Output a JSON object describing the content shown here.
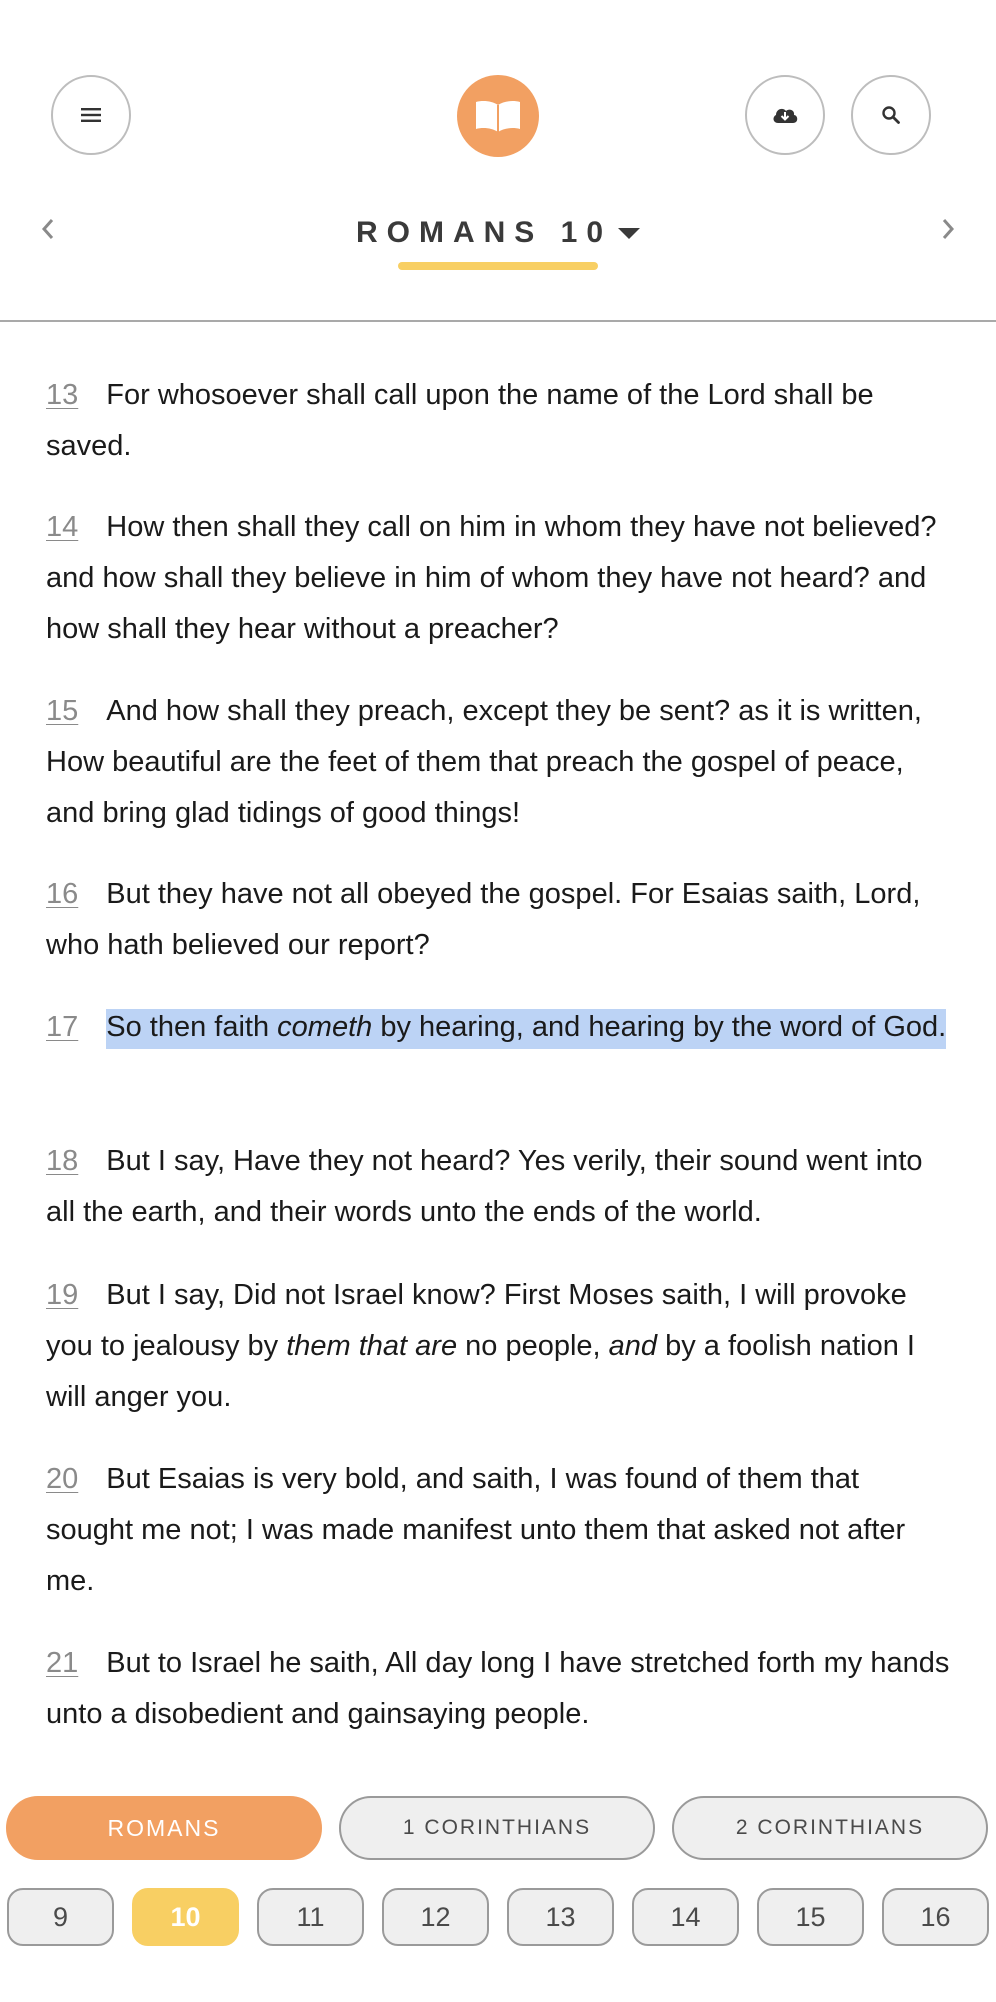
{
  "header": {
    "chapter_label": "ROMANS 10",
    "icons": {
      "menu": "hamburger-menu-icon",
      "logo": "open-book-icon",
      "download": "cloud-download-icon",
      "search": "search-icon",
      "prev": "chevron-left-icon",
      "next": "chevron-right-icon",
      "dropdown": "caret-down-icon"
    }
  },
  "colors": {
    "accent_orange": "#f2a062",
    "accent_yellow": "#f8cf63",
    "highlight_blue": "#bcd3f5"
  },
  "verses": [
    {
      "num": "13",
      "text": "For whosoever shall call upon the name of the Lord shall be saved."
    },
    {
      "num": "14",
      "text": "How then shall they call on him in whom they have not believed? and how shall they believe in him of whom they have not heard? and how shall they hear without a preacher?"
    },
    {
      "num": "15",
      "text": "And how shall they preach, except they be sent? as it is written, How beautiful are the feet of them that preach the gospel of peace, and bring glad tidings of good things!"
    },
    {
      "num": "16",
      "text": "But they have not all obeyed the gospel. For Esaias saith, Lord, who hath believed our report?"
    },
    {
      "num": "17",
      "text_a": "So then faith ",
      "text_italic": "cometh",
      "text_b": " by hearing, and hearing by the word of God.",
      "highlighted": true
    },
    {
      "num": "18",
      "text": "But I say, Have they not heard? Yes verily, their sound went into all the earth, and their words unto the ends of the world."
    },
    {
      "num": "19",
      "text_a": "But I say, Did not Israel know? First Moses saith, I will provoke you to jealousy by ",
      "text_italic_1": "them that are",
      "text_b": " no people, ",
      "text_italic_2": "and",
      "text_c": " by a foolish nation I will anger you."
    },
    {
      "num": "20",
      "text": "But Esaias is very bold, and saith, I was found of them that sought me not; I was made manifest unto them that asked not after me."
    },
    {
      "num": "21",
      "text": "But to Israel he saith, All day long I have stretched forth my hands unto a disobedient and gainsaying people."
    }
  ],
  "books": [
    {
      "label": "ROMANS",
      "active": true
    },
    {
      "label": "1 CORINTHIANS",
      "active": false
    },
    {
      "label": "2 CORINTHIANS",
      "active": false
    }
  ],
  "chapters": [
    {
      "label": "9",
      "active": false
    },
    {
      "label": "10",
      "active": true
    },
    {
      "label": "11",
      "active": false
    },
    {
      "label": "12",
      "active": false
    },
    {
      "label": "13",
      "active": false
    },
    {
      "label": "14",
      "active": false
    },
    {
      "label": "15",
      "active": false
    },
    {
      "label": "16",
      "active": false
    }
  ]
}
